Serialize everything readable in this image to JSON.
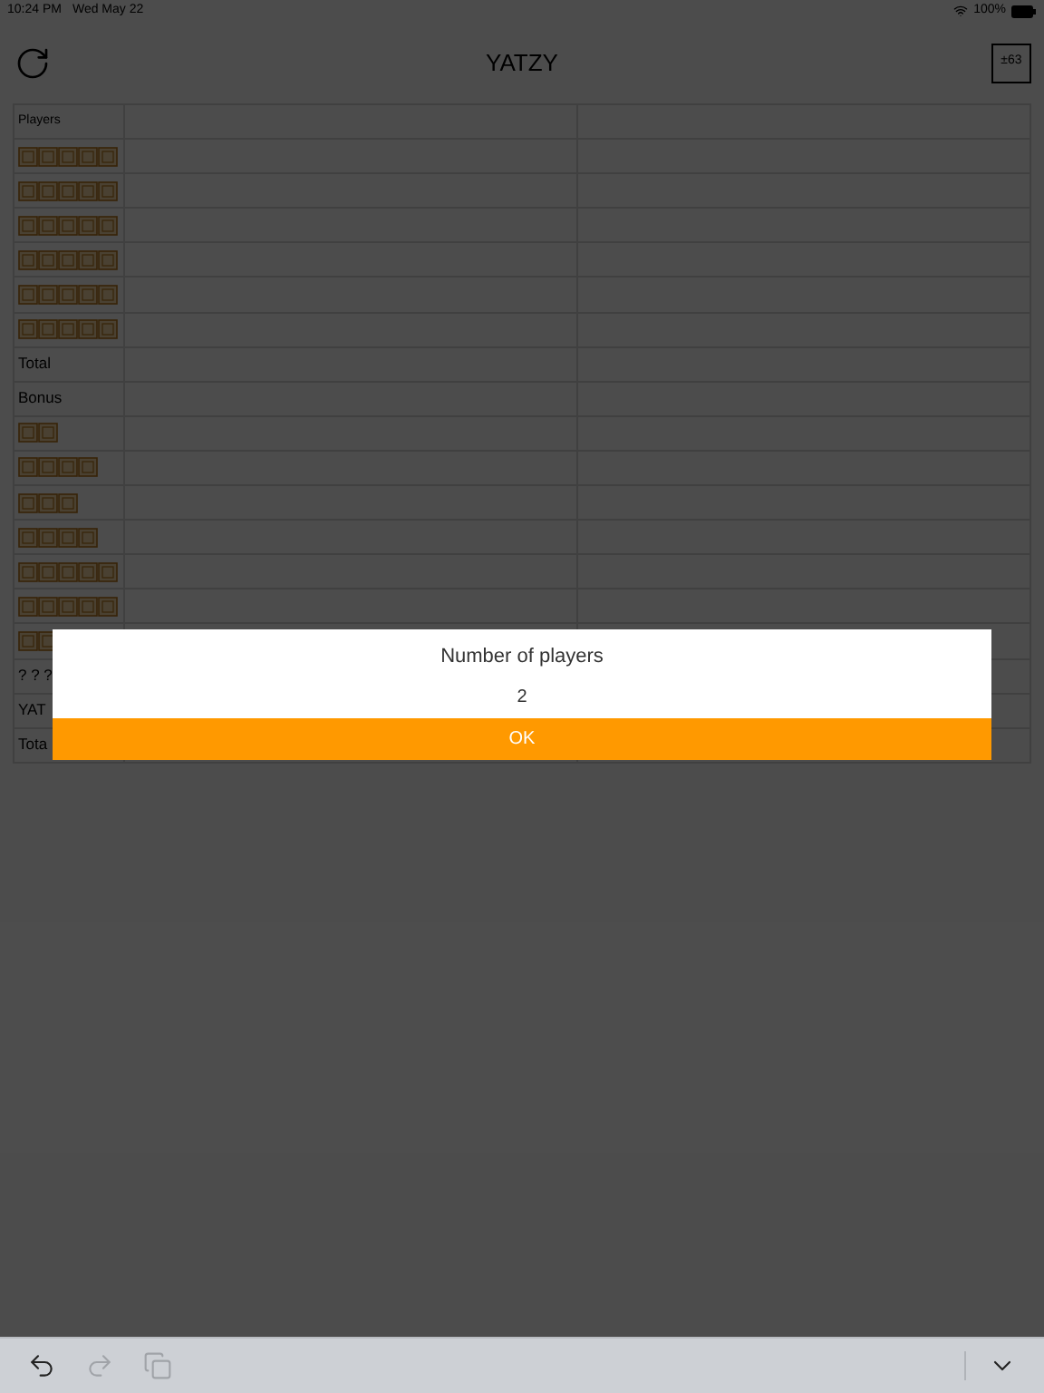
{
  "status_bar": {
    "time": "10:24 PM",
    "date": "Wed May 22",
    "battery": "100%"
  },
  "nav": {
    "title": "YATZY",
    "bonus_button": "±63"
  },
  "table": {
    "rows": [
      {
        "kind": "header",
        "label": "Players"
      },
      {
        "kind": "dice5"
      },
      {
        "kind": "dice5"
      },
      {
        "kind": "dice5"
      },
      {
        "kind": "dice5"
      },
      {
        "kind": "dice5"
      },
      {
        "kind": "dice5"
      },
      {
        "kind": "text",
        "label": "Total"
      },
      {
        "kind": "text",
        "label": "Bonus"
      },
      {
        "kind": "dice2"
      },
      {
        "kind": "dice4"
      },
      {
        "kind": "dice3"
      },
      {
        "kind": "dice4"
      },
      {
        "kind": "dice5"
      },
      {
        "kind": "dice5"
      },
      {
        "kind": "dice2"
      },
      {
        "kind": "text",
        "label": "? ? ?"
      },
      {
        "kind": "text",
        "label": "YAT"
      },
      {
        "kind": "text",
        "label": "Tota"
      }
    ]
  },
  "dialog": {
    "title": "Number of players",
    "value": "2",
    "button": "OK"
  },
  "keyboard_bar": {
    "items": [
      {
        "kind": "undo",
        "disabled": false
      },
      {
        "kind": "redo",
        "disabled": true
      },
      {
        "kind": "paste",
        "disabled": true
      },
      {
        "kind": "hide-keyboard",
        "disabled": false
      }
    ]
  }
}
